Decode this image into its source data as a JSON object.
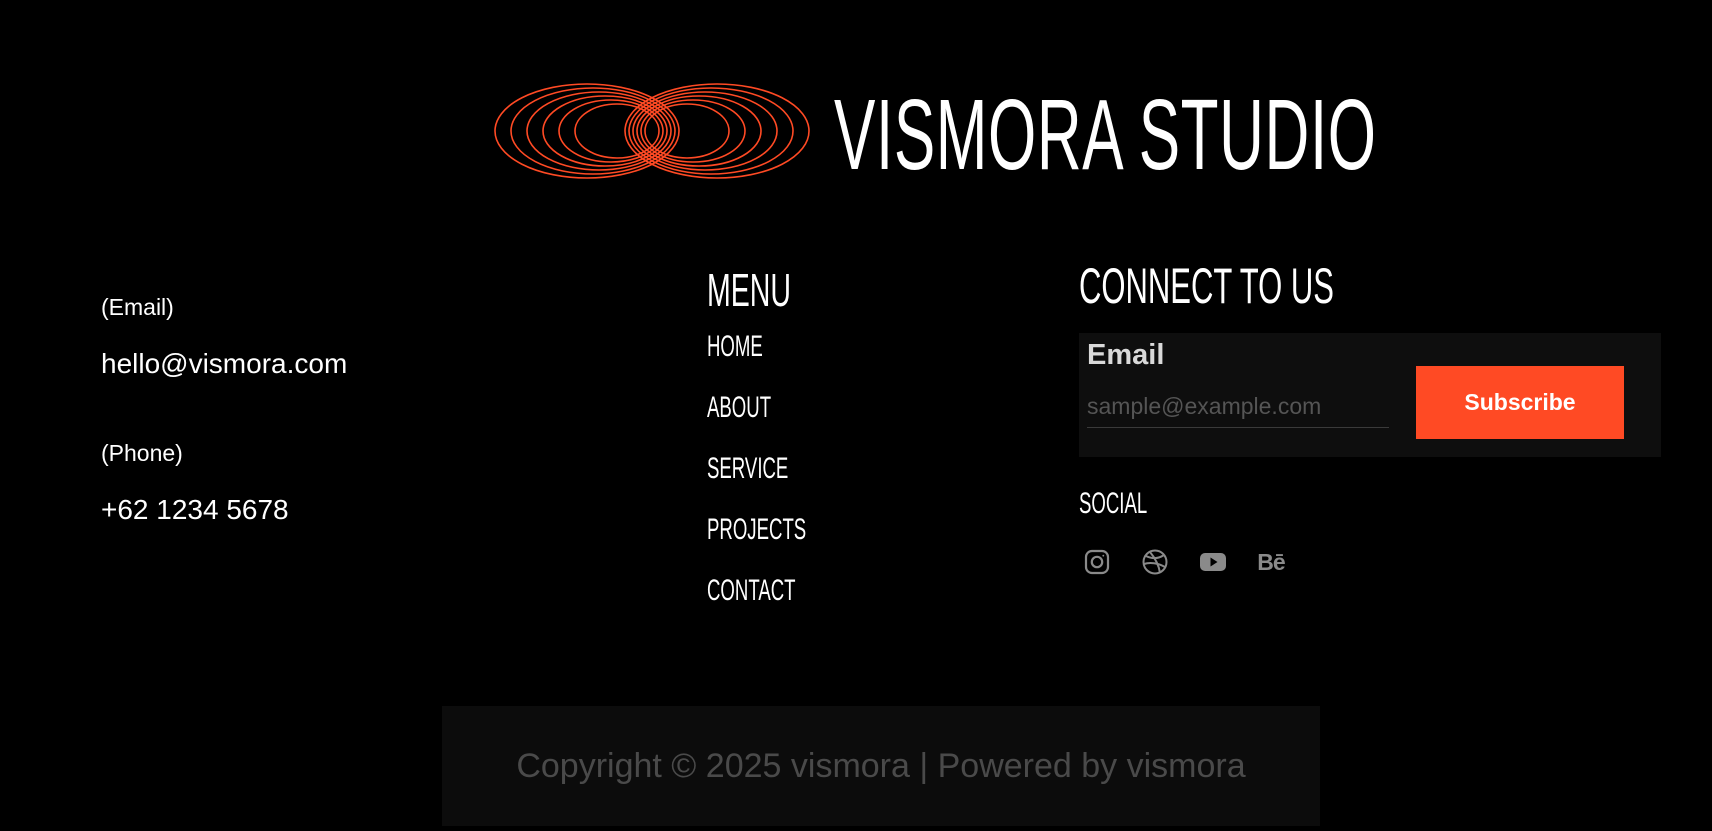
{
  "brand": {
    "name": "VISMORA STUDIO",
    "logo_icon": "interlocking-orbit-rings-logo",
    "accent_color": "#ff4a24"
  },
  "contact": {
    "email_label": "(Email)",
    "email_value": "hello@vismora.com",
    "phone_label": "(Phone)",
    "phone_value": "+62 1234 5678"
  },
  "menu": {
    "title": "MENU",
    "items": [
      {
        "label": "HOME"
      },
      {
        "label": "ABOUT"
      },
      {
        "label": "SERVICE"
      },
      {
        "label": "PROJECTS"
      },
      {
        "label": "CONTACT"
      }
    ]
  },
  "connect": {
    "title": "CONNECT TO US",
    "email_label": "Email",
    "email_placeholder": "sample@example.com",
    "subscribe_label": "Subscribe",
    "social_title": "SOCIAL",
    "social_icons": [
      "instagram-icon",
      "dribbble-icon",
      "youtube-icon",
      "behance-icon"
    ],
    "behance_glyph": "Bē"
  },
  "footer": {
    "copyright": "Copyright © 2025 vismora | Powered by vismora"
  }
}
